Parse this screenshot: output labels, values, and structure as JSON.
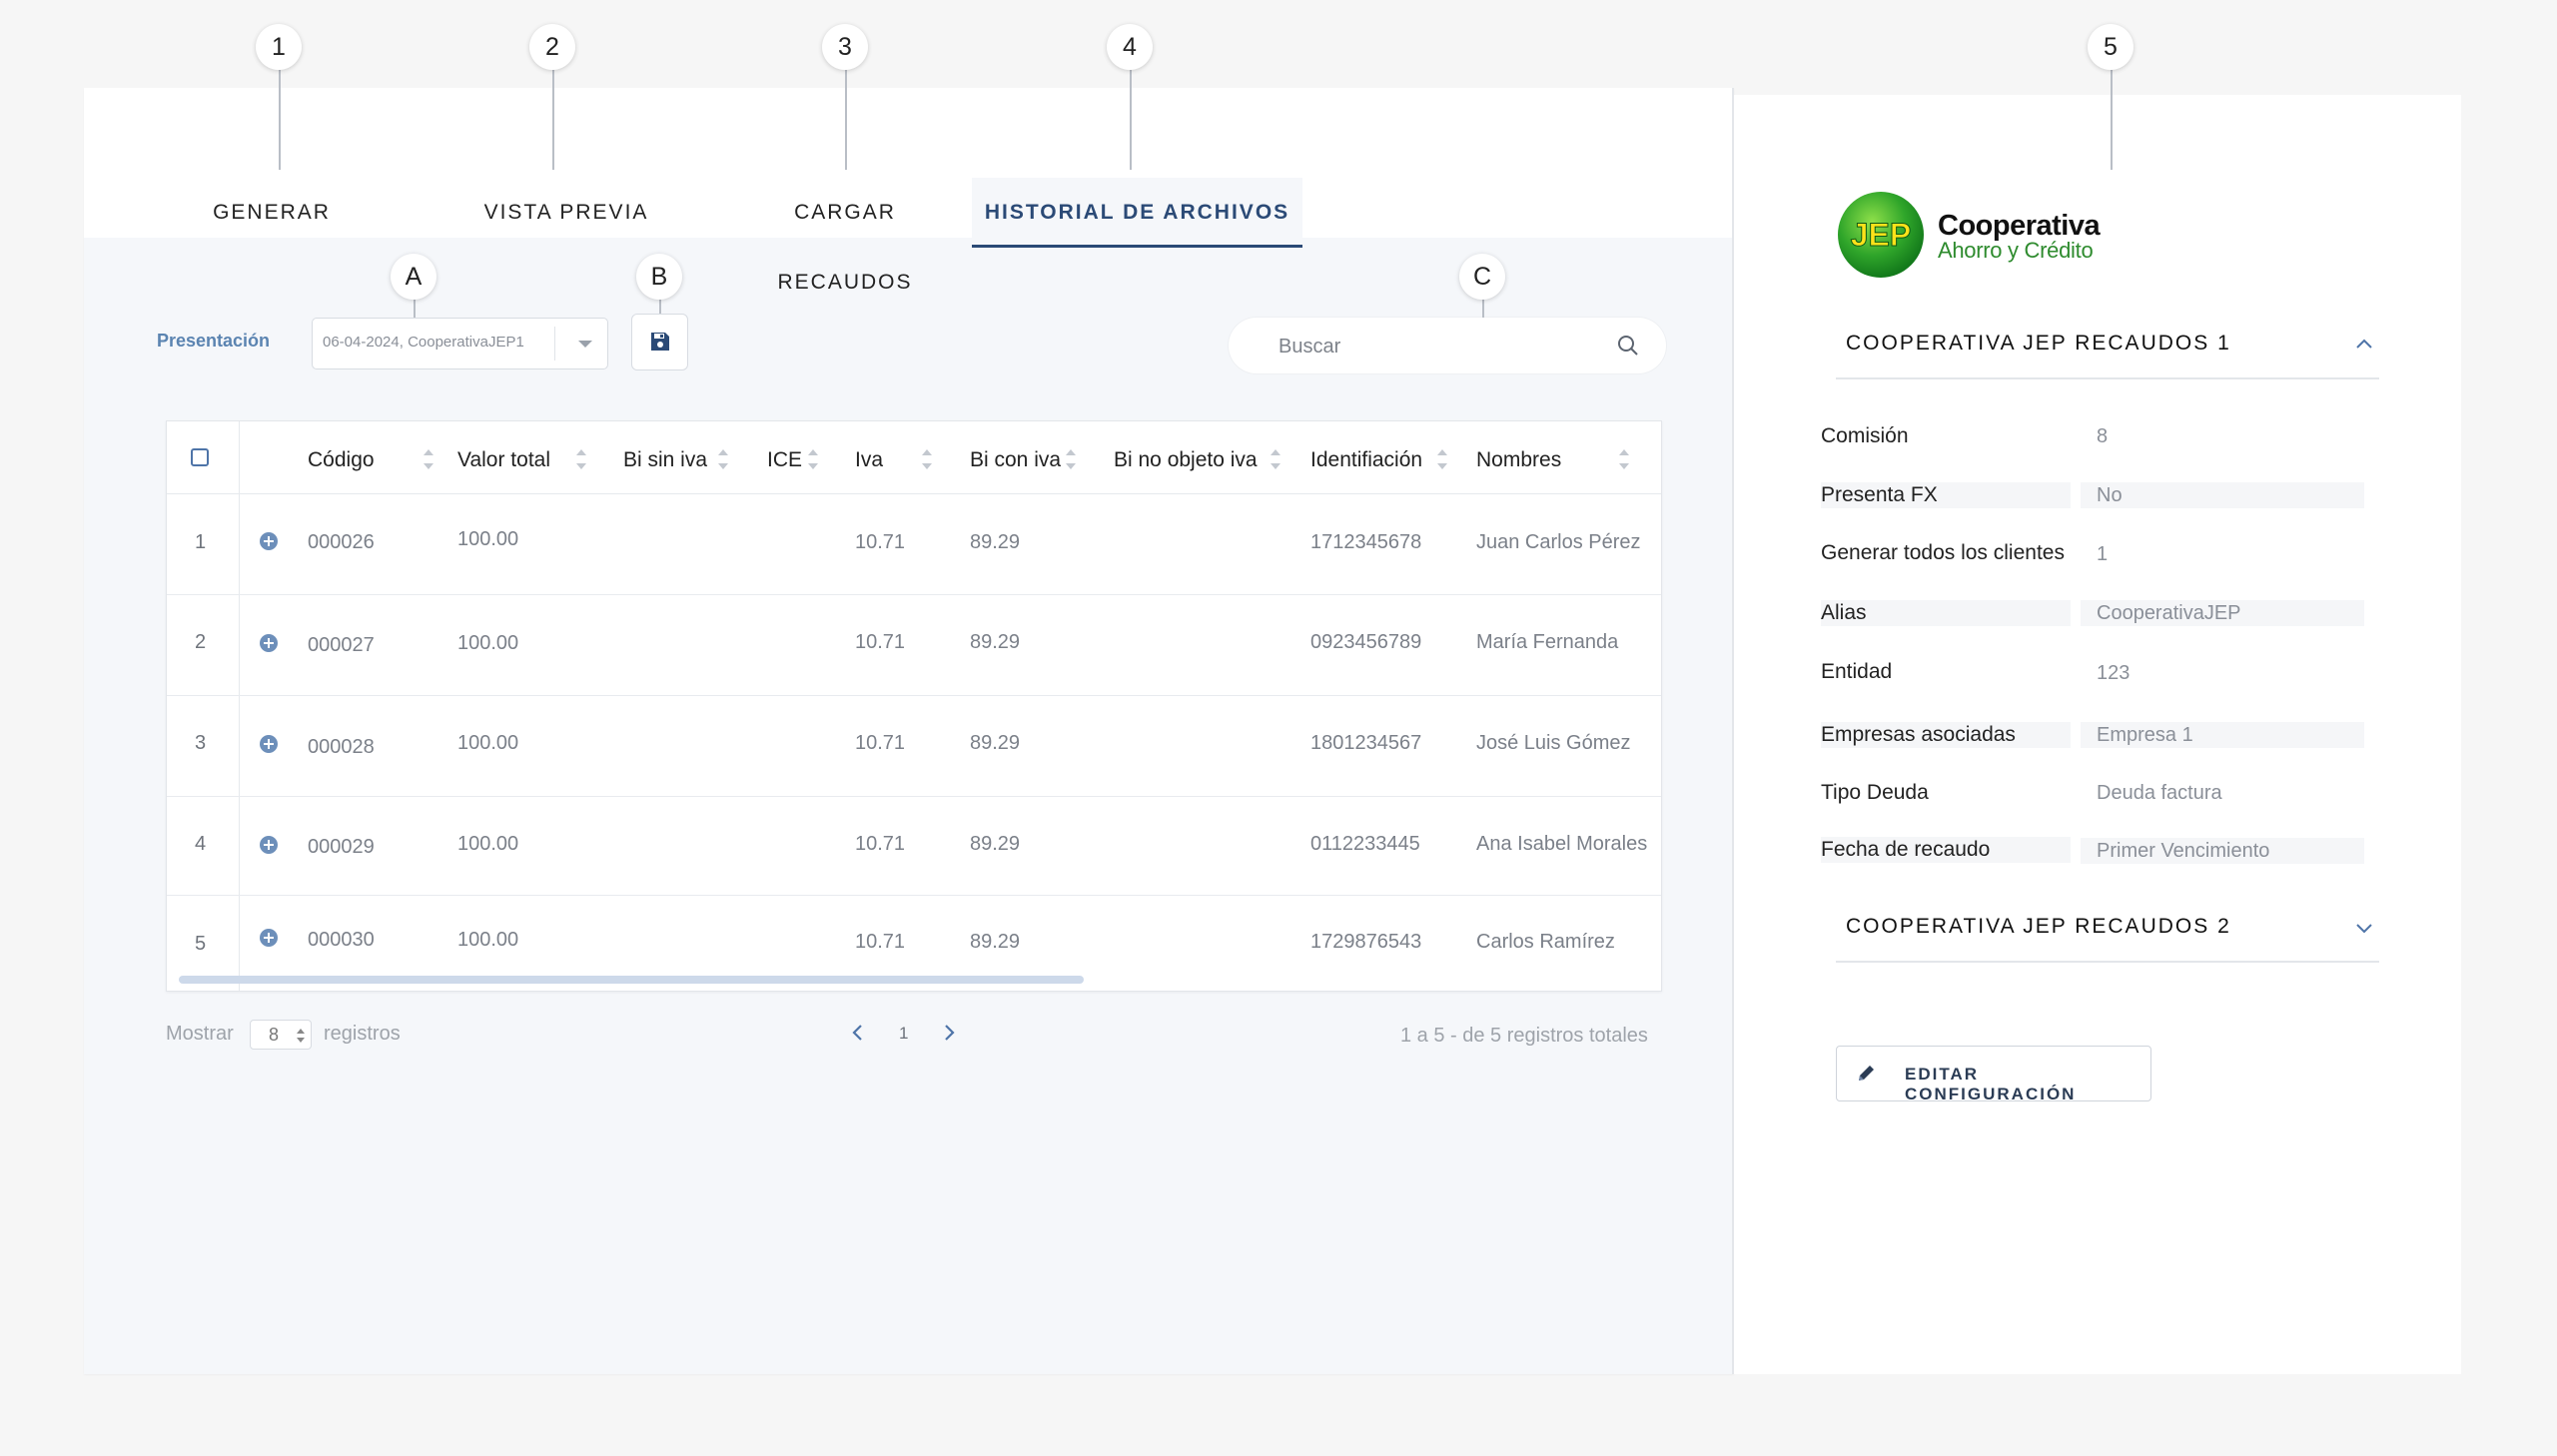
{
  "callouts": {
    "numbers": [
      "1",
      "2",
      "3",
      "4",
      "5"
    ],
    "letters": [
      "A",
      "B",
      "C"
    ]
  },
  "tabs": [
    {
      "label": "GENERAR",
      "active": false
    },
    {
      "label": "VISTA PREVIA",
      "active": false
    },
    {
      "label": "CARGAR RECAUDOS",
      "active": false
    },
    {
      "label": "HISTORIAL DE ARCHIVOS",
      "active": true
    }
  ],
  "toolbar": {
    "presentation_label": "Presentación",
    "presentation_value": "06-04-2024, CooperativaJEP1",
    "save_icon": "floppy-disk-icon",
    "search_placeholder": "Buscar",
    "search_icon": "search-icon"
  },
  "table": {
    "columns": [
      "Código",
      "Valor total",
      "Bi sin iva",
      "ICE",
      "Iva",
      "Bi con iva",
      "Bi no objeto iva",
      "Identifiación",
      "Nombres"
    ],
    "rows": [
      {
        "n": "1",
        "codigo": "000026",
        "valor_total": "100.00",
        "bi_sin_iva": "",
        "ice": "",
        "iva": "10.71",
        "bi_con_iva": "89.29",
        "bi_no_objeto": "",
        "identificacion": "1712345678",
        "nombres": "Juan Carlos Pérez"
      },
      {
        "n": "2",
        "codigo": "000027",
        "valor_total": "100.00",
        "bi_sin_iva": "",
        "ice": "",
        "iva": "10.71",
        "bi_con_iva": "89.29",
        "bi_no_objeto": "",
        "identificacion": "0923456789",
        "nombres": "María Fernanda"
      },
      {
        "n": "3",
        "codigo": "000028",
        "valor_total": "100.00",
        "bi_sin_iva": "",
        "ice": "",
        "iva": "10.71",
        "bi_con_iva": "89.29",
        "bi_no_objeto": "",
        "identificacion": "1801234567",
        "nombres": "José Luis Gómez"
      },
      {
        "n": "4",
        "codigo": "000029",
        "valor_total": "100.00",
        "bi_sin_iva": "",
        "ice": "",
        "iva": "10.71",
        "bi_con_iva": "89.29",
        "bi_no_objeto": "",
        "identificacion": "0112233445",
        "nombres": "Ana Isabel Morales"
      },
      {
        "n": "5",
        "codigo": "000030",
        "valor_total": "100.00",
        "bi_sin_iva": "",
        "ice": "",
        "iva": "10.71",
        "bi_con_iva": "89.29",
        "bi_no_objeto": "",
        "identificacion": "1729876543",
        "nombres": "Carlos Ramírez"
      }
    ]
  },
  "pagination": {
    "show_label": "Mostrar",
    "page_size": "8",
    "records_label": "registros",
    "current_page": "1",
    "summary": "1 a 5 - de 5 registros totales"
  },
  "right_panel": {
    "logo": {
      "mark": "JEP",
      "title": "Cooperativa",
      "subtitle": "Ahorro y Crédito"
    },
    "section1_title": "COOPERATIVA JEP RECAUDOS 1",
    "fields": [
      {
        "label": "Comisión",
        "value": "8"
      },
      {
        "label": "Presenta FX",
        "value": "No"
      },
      {
        "label": "Generar todos los clientes",
        "value": "1"
      },
      {
        "label": "Alias",
        "value": "CooperativaJEP"
      },
      {
        "label": "Entidad",
        "value": "123"
      },
      {
        "label": "Empresas asociadas",
        "value": "Empresa 1"
      },
      {
        "label": "Tipo Deuda",
        "value": "Deuda factura"
      },
      {
        "label": "Fecha de recaudo",
        "value": "Primer Vencimiento"
      }
    ],
    "section2_title": "COOPERATIVA JEP RECAUDOS 2",
    "edit_button": "EDITAR CONFIGURACIÓN"
  },
  "colors": {
    "accent": "#2b4a76",
    "link_blue": "#5b84b1",
    "logo_green": "#2e8b2e"
  }
}
